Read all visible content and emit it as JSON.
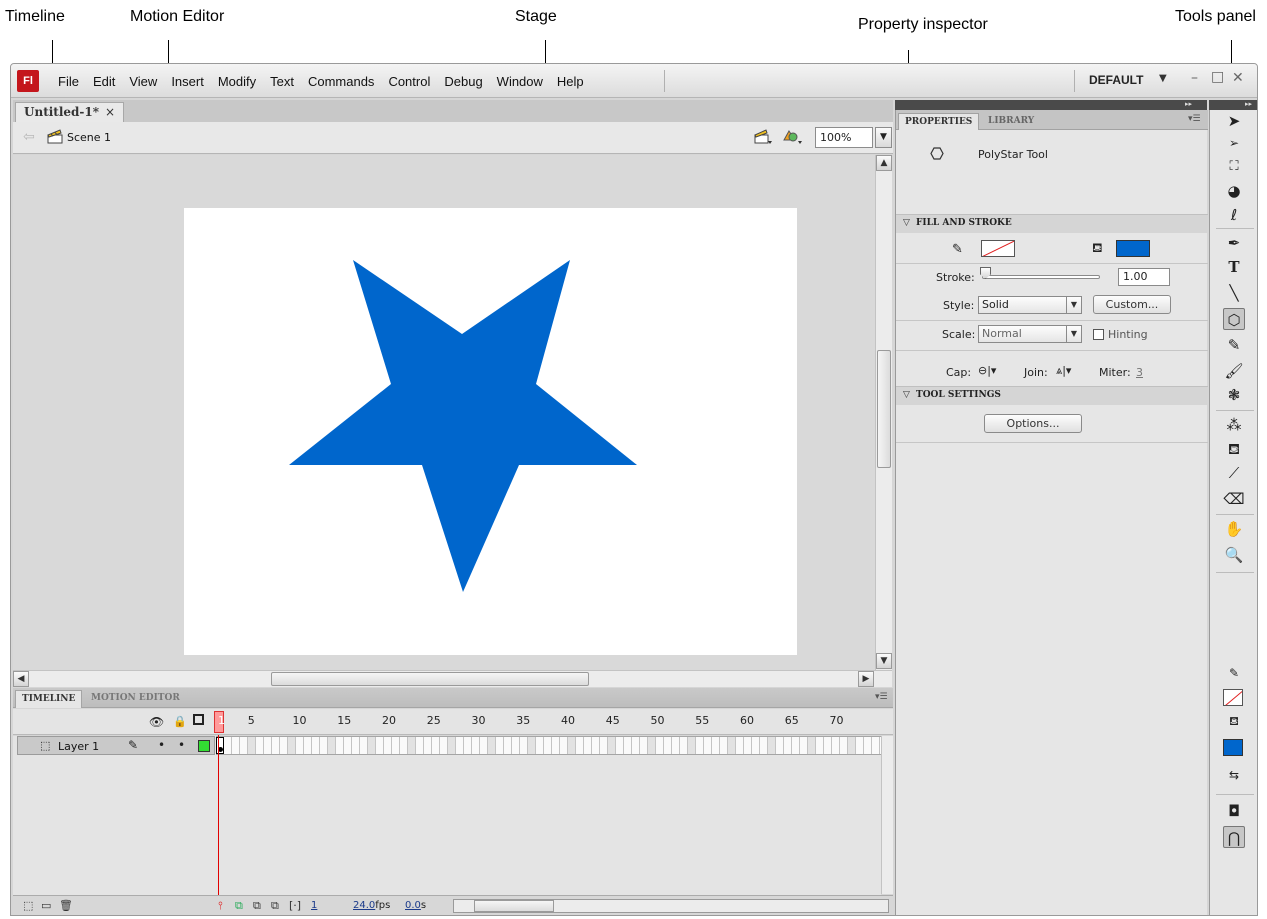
{
  "callouts": {
    "timeline": "Timeline",
    "motion_editor": "Motion Editor",
    "stage": "Stage",
    "property_inspector": "Property inspector",
    "tools_panel": "Tools panel"
  },
  "app": {
    "logo": "Fl",
    "menu": [
      "File",
      "Edit",
      "View",
      "Insert",
      "Modify",
      "Text",
      "Commands",
      "Control",
      "Debug",
      "Window",
      "Help"
    ],
    "workspace": "DEFAULT",
    "window_controls": {
      "minimize": "–",
      "maximize": "□",
      "close": "✕"
    }
  },
  "document": {
    "tab_title": "Untitled-1*",
    "tab_close": "×",
    "scene": "Scene 1",
    "zoom": "100%",
    "star_color": "#0066cc"
  },
  "timeline": {
    "tabs": [
      "TIMELINE",
      "MOTION EDITOR"
    ],
    "frame_numbers": [
      "1",
      "5",
      "10",
      "15",
      "20",
      "25",
      "30",
      "35",
      "40",
      "45",
      "50",
      "55",
      "60",
      "65",
      "70"
    ],
    "layer_name": "Layer 1",
    "current_frame": "1",
    "fps_value": "24.0",
    "fps_unit": "fps",
    "time_value": "0.0",
    "time_unit": "s"
  },
  "properties": {
    "tabs": [
      "PROPERTIES",
      "LIBRARY"
    ],
    "tool_name": "PolyStar Tool",
    "fill_stroke_section": "FILL AND STROKE",
    "stroke_label": "Stroke:",
    "stroke_value": "1.00",
    "style_label": "Style:",
    "style_value": "Solid",
    "custom_button": "Custom...",
    "scale_label": "Scale:",
    "scale_value": "Normal",
    "hinting_label": "Hinting",
    "cap_label": "Cap:",
    "join_label": "Join:",
    "miter_label": "Miter:",
    "miter_value": "3",
    "fill_color": "#0066cc",
    "tool_settings_section": "TOOL SETTINGS",
    "options_button": "Options..."
  }
}
